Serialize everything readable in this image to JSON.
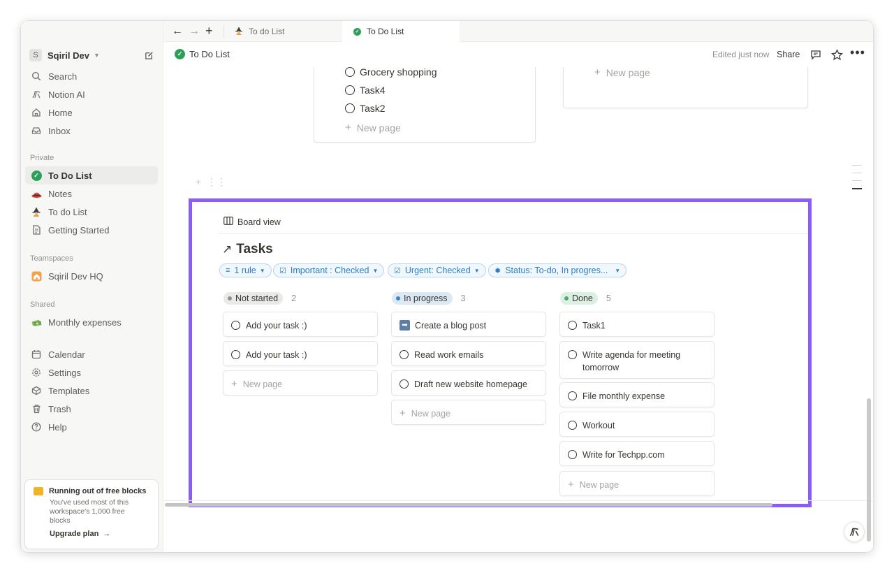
{
  "workspace": {
    "initial": "S",
    "name": "Sqiril Dev"
  },
  "sidebar": {
    "top_items": [
      {
        "label": "Search",
        "icon": "search-icon"
      },
      {
        "label": "Notion AI",
        "icon": "notion-ai-icon"
      },
      {
        "label": "Home",
        "icon": "home-icon"
      },
      {
        "label": "Inbox",
        "icon": "inbox-icon"
      }
    ],
    "private_label": "Private",
    "private_items": [
      {
        "label": "To Do List",
        "icon": "green-check-icon",
        "active": true
      },
      {
        "label": "Notes",
        "icon": "red-hat-emoji-icon"
      },
      {
        "label": "To do List",
        "icon": "witch-emoji-icon"
      },
      {
        "label": "Getting Started",
        "icon": "page-icon"
      }
    ],
    "teamspaces_label": "Teamspaces",
    "teamspace_items": [
      {
        "label": "Sqiril Dev HQ",
        "icon": "house-emoji-icon"
      }
    ],
    "shared_label": "Shared",
    "shared_items": [
      {
        "label": "Monthly expenses",
        "icon": "money-emoji-icon"
      }
    ],
    "bottom_items": [
      {
        "label": "Calendar",
        "icon": "calendar-icon"
      },
      {
        "label": "Settings",
        "icon": "settings-icon"
      },
      {
        "label": "Templates",
        "icon": "templates-icon"
      },
      {
        "label": "Trash",
        "icon": "trash-icon"
      },
      {
        "label": "Help",
        "icon": "help-icon"
      }
    ],
    "upgrade": {
      "title": "Running out of free blocks",
      "body_1": "You've used most of this",
      "body_2": "workspace's 1,000 free",
      "body_3": "blocks",
      "link": "Upgrade plan"
    }
  },
  "tabs": [
    {
      "label": "To do List",
      "icon": "witch-emoji-icon",
      "active": false
    },
    {
      "label": "To Do List",
      "icon": "green-check-icon",
      "active": true
    }
  ],
  "header": {
    "breadcrumb": "To Do List",
    "edited": "Edited just now",
    "share": "Share"
  },
  "top_card": {
    "items": [
      "Grocery shopping",
      "Task4",
      "Task2"
    ],
    "new_page": "New page"
  },
  "top_card_2": {
    "new_page": "New page"
  },
  "board": {
    "view_label": "Board view",
    "title": "Tasks",
    "filters": [
      {
        "label": "1 rule",
        "icon": "filter-icon"
      },
      {
        "label": "Important : Checked",
        "icon": "checkbox-icon"
      },
      {
        "label": "Urgent: Checked",
        "icon": "checkbox-icon"
      },
      {
        "label": "Status: To-do, In progres...",
        "icon": "status-icon"
      }
    ],
    "columns": [
      {
        "name": "Not started",
        "count": "2",
        "pill_color": "#e9e9e7",
        "dot_color": "#91918e",
        "cards": [
          "Add your task :)",
          "Add your task :)"
        ]
      },
      {
        "name": "In progress",
        "count": "3",
        "pill_color": "#dce9f5",
        "dot_color": "#3d85c6",
        "cards": [
          "Create a blog post",
          "Read work emails",
          "Draft new website homepage"
        ]
      },
      {
        "name": "Done",
        "count": "5",
        "pill_color": "#dcefe3",
        "dot_color": "#4dab6f",
        "cards": [
          "Task1",
          "Write agenda for meeting tomorrow",
          "File monthly expense",
          "Workout",
          "Write for Techpp.com"
        ]
      }
    ],
    "new_page": "New page"
  },
  "colors": {
    "highlight": "#8b5cf6",
    "accent_blue": "#2b7cc4",
    "check_green": "#2e9e5a"
  }
}
